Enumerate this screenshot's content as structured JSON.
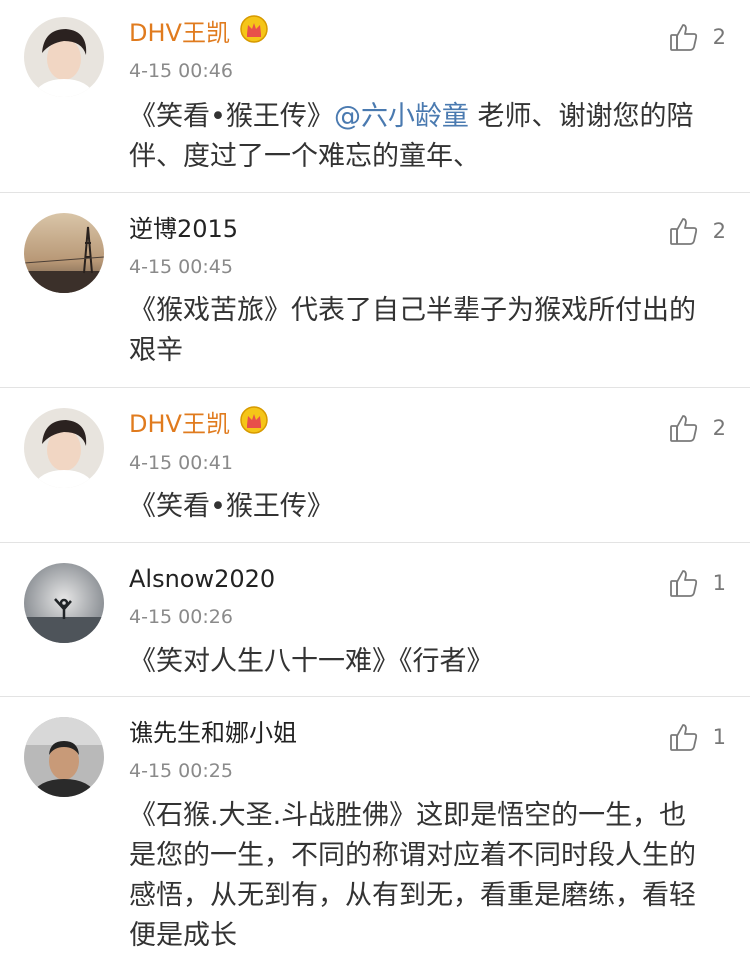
{
  "comments": [
    {
      "user": "DHV王凯",
      "vip": true,
      "time": "4-15 00:46",
      "likes": "2",
      "text_before": "《笑看•猴王传》",
      "mention": "@六小龄童",
      "text_after": " 老师、谢谢您的陪伴、度过了一个难忘的童年、"
    },
    {
      "user": "逆博2015",
      "vip": false,
      "time": "4-15 00:45",
      "likes": "2",
      "text": "《猴戏苦旅》代表了自己半辈子为猴戏所付出的艰辛"
    },
    {
      "user": "DHV王凯",
      "vip": true,
      "time": "4-15 00:41",
      "likes": "2",
      "text": "《笑看•猴王传》"
    },
    {
      "user": "Alsnow2020",
      "vip": false,
      "time": "4-15 00:26",
      "likes": "1",
      "text": "《笑对人生八十一难》《行者》"
    },
    {
      "user": "谯先生和娜小姐",
      "vip": false,
      "time": "4-15 00:25",
      "likes": "1",
      "text": "《石猴.大圣.斗战胜佛》这即是悟空的一生，也是您的一生，不同的称谓对应着不同时段人生的感悟，从无到有，从有到无，看重是磨练，看轻便是成长"
    }
  ],
  "icons": {
    "like": "thumbs-up-icon",
    "vip": "crown-icon",
    "accent": "#e07b1e",
    "mention_color": "#4a7ab0"
  }
}
